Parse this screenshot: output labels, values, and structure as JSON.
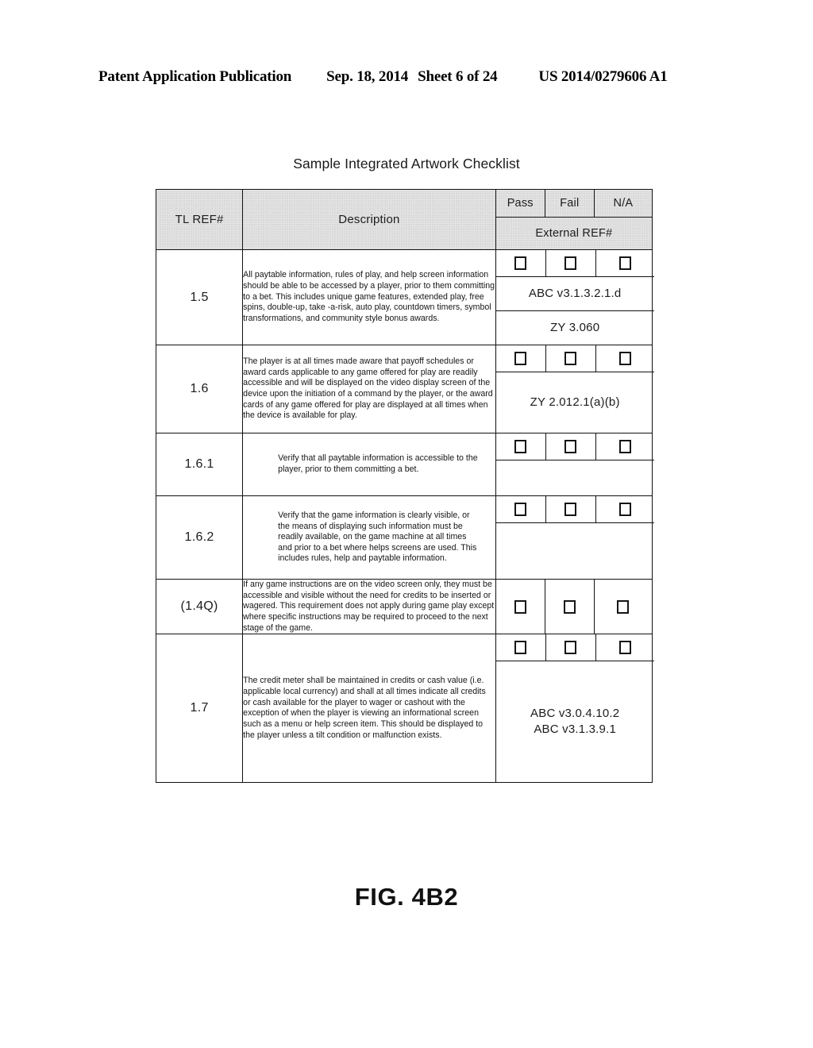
{
  "page_header": {
    "publication": "Patent Application Publication",
    "date": "Sep. 18, 2014",
    "sheet": "Sheet 6 of 24",
    "patent_number": "US 2014/0279606 A1"
  },
  "figure": {
    "table_title": "Sample Integrated Artwork Checklist",
    "caption": "FIG. 4B2"
  },
  "table": {
    "headers": {
      "ref": "TL REF#",
      "description": "Description",
      "pass": "Pass",
      "fail": "Fail",
      "na": "N/A",
      "external_ref": "External REF#"
    },
    "checkbox_glyph": "empty-checkbox",
    "rows": [
      {
        "ref": "1.5",
        "description": "All paytable information, rules of play, and help screen information should be able to be accessed by a player, prior to them committing to a bet. This includes unique game features, extended play, free spins, double-up, take -a-risk, auto play, countdown timers, symbol transformations, and community style bonus awards.",
        "external_refs": [
          "ABC v3.1.3.2.1.d",
          "ZY 3.060"
        ]
      },
      {
        "ref": "1.6",
        "description": "The player is at all times made aware that payoff schedules or award cards applicable to any game offered for play are readily accessible and will be displayed on the video display screen of the device upon the initiation of a command by the player, or the award cards of any game offered for play are displayed at all times when the device is available for play.",
        "external_refs": [
          "ZY 2.012.1(a)(b)"
        ]
      },
      {
        "ref": "1.6.1",
        "description": "Verify that all paytable information is accessible to the player, prior to them committing a bet.",
        "external_refs": [
          ""
        ]
      },
      {
        "ref": "1.6.2",
        "description": "Verify that the game information is clearly visible, or the means of displaying such information must be readily available, on the game machine at all times and prior to a bet where helps screens are used. This includes rules, help and paytable information.",
        "external_refs": [
          ""
        ]
      },
      {
        "ref": "(1.4Q)",
        "description": "If any game instructions are on the video screen only, they must be accessible and visible without the need for credits to be inserted or wagered. This requirement does not apply during game play except where specific instructions may be required to proceed to the next stage of the game.",
        "external_refs": []
      },
      {
        "ref": "1.7",
        "description": "The credit meter shall be maintained in credits or cash value (i.e. applicable local currency) and shall at all times indicate all credits or cash available for the player to wager or cashout with the exception of when the player is viewing an informational screen such as a menu or help screen item. This should be displayed to the player unless a tilt condition or malfunction exists.",
        "external_refs": [
          "ABC v3.0.4.10.2\nABC v3.1.3.9.1"
        ]
      }
    ]
  }
}
